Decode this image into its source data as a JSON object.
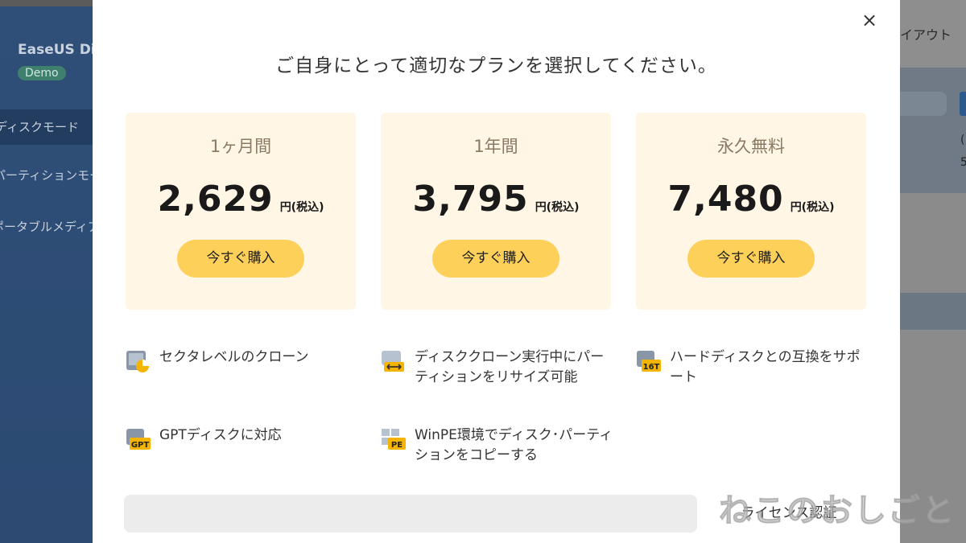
{
  "background_app": {
    "title": "EaseUS Dis",
    "badge": "Demo",
    "sidebar_items": [
      "ディスクモード",
      "パーティションモード",
      "ポータブルメディア"
    ],
    "logout_text": "イアウト",
    "num1": "(",
    "num2": "5"
  },
  "modal": {
    "close_label": "×",
    "title": "ご自身にとって適切なプランを選択してください。",
    "plans": [
      {
        "name": "1ヶ月間",
        "price": "2,629",
        "tax": "円(税込)",
        "button": "今すぐ購入"
      },
      {
        "name": "1年間",
        "price": "3,795",
        "tax": "円(税込)",
        "button": "今すぐ購入"
      },
      {
        "name": "永久無料",
        "price": "7,480",
        "tax": "円(税込)",
        "button": "今すぐ購入"
      }
    ],
    "features": [
      {
        "icon": "sector-clone-icon",
        "text": "セクタレベルのクローン"
      },
      {
        "icon": "resize-partition-icon",
        "text": "ディスククローン実行中にパーティションをリサイズ可能"
      },
      {
        "icon": "16t-disk-icon",
        "icon_label": "16T",
        "text": "ハードディスクとの互換をサポート"
      },
      {
        "icon": "gpt-disk-icon",
        "icon_label": "GPT",
        "text": "GPTディスクに対応"
      },
      {
        "icon": "winpe-icon",
        "icon_label": "PE",
        "text": "WinPE環境でディスク･パーティションをコピーする"
      }
    ],
    "license_button": "ライセンス認証"
  },
  "watermark": "ねこのおしごと",
  "colors": {
    "card_bg": "#fff6e6",
    "buy_button": "#fdd05a",
    "sidebar": "#2f4f78",
    "icon_accent": "#f5b400",
    "icon_gray": "#8896a8"
  }
}
